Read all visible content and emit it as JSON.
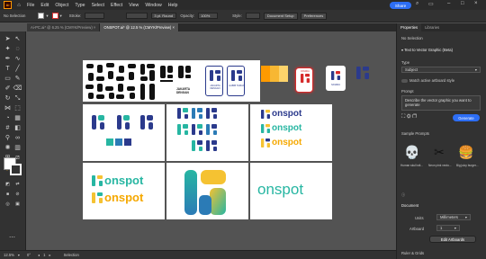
{
  "app": {
    "logo": "Ai",
    "menus": [
      "File",
      "Edit",
      "Object",
      "Type",
      "Select",
      "Effect",
      "View",
      "Window",
      "Help"
    ],
    "share": "Share"
  },
  "control": {
    "selection": "No Selection",
    "stroke_label": "Stroke:",
    "brush": "3 pt. Round",
    "opacity_label": "Opacity:",
    "opacity_value": "100%",
    "style_label": "Style:",
    "doc_setup": "Document Setup",
    "preferences": "Preferences"
  },
  "tabs": [
    {
      "label": "Ai-PC.ai* @ 6.25 % (CMYK/Preview)"
    },
    {
      "label": "ONSPOT.ai* @ 12.5 % (CMYK/Preview)"
    }
  ],
  "status": {
    "zoom": "12.5%",
    "angle": "0°",
    "page": "1",
    "tool": "Selection"
  },
  "panel": {
    "tabs": [
      "Properties",
      "Libraries"
    ],
    "no_selection": "No Selection",
    "vector_text": "Text to Vector Graphic (Beta)",
    "type_label": "Type",
    "type_value": "Subject",
    "match_style": "Match active artboard style",
    "prompt_label": "Prompt",
    "prompt_text": "Describe the vector graphic you want to generate",
    "generate": "Generate",
    "samples_label": "Sample Prompts",
    "samples": [
      "Human skull wit...",
      "Neon pink vecto...",
      "Big juicy burger..."
    ],
    "document_label": "Document",
    "units_label": "Units",
    "units_value": "Millimeters",
    "artboard_label": "Artboard",
    "artboard_value": "1",
    "edit_artboards": "Edit Artboards",
    "rulers": "Ruler & Grids"
  },
  "artwork": {
    "logo_text": "onspot",
    "sign1": "JAKARTA DENGAN",
    "sign2": "HABIB TAMAN",
    "sign3": "PASDDA",
    "sign4": "NASDRA",
    "jakarta": "JAKARTA DENGAN"
  },
  "colors": {
    "teal": "#27b6a2",
    "navy": "#2b3a8c",
    "orange": "#ff9a00",
    "yellow": "#f5c232",
    "red": "#d62b2b",
    "blue_accent": "#2d6ef5"
  }
}
